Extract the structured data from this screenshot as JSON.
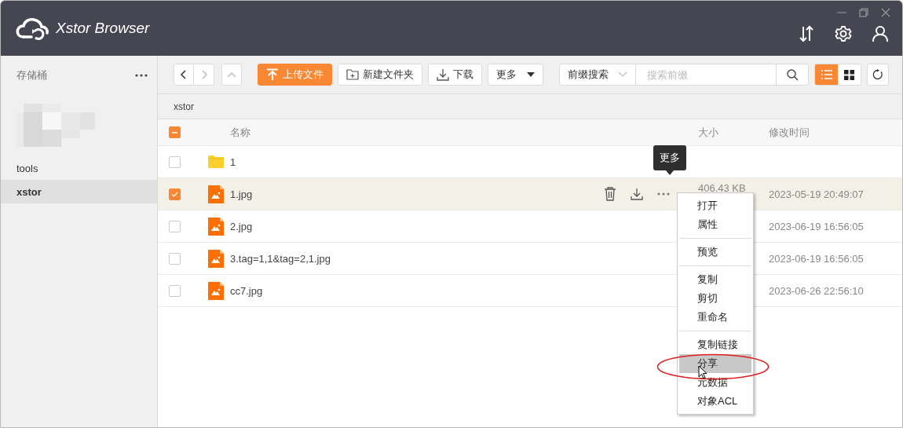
{
  "window": {
    "title": "Xstor Browser"
  },
  "sidebar": {
    "heading": "存储桶",
    "items": [
      {
        "kind": "redacted",
        "selected": false
      },
      {
        "kind": "bucket",
        "label": "tools",
        "selected": false
      },
      {
        "kind": "bucket",
        "label": "xstor",
        "selected": true
      }
    ]
  },
  "toolbar": {
    "nav": [
      {
        "kind": "back",
        "disabled": false
      },
      {
        "kind": "forward",
        "disabled": true
      },
      {
        "kind": "up",
        "disabled": true
      }
    ],
    "buttons": [
      {
        "kind": "upload",
        "label": "上传文件",
        "primary": true
      },
      {
        "kind": "new-folder",
        "label": "新建文件夹",
        "primary": false
      },
      {
        "kind": "download",
        "label": "下载",
        "primary": false
      },
      {
        "kind": "dropdown",
        "label": "更多",
        "primary": false
      }
    ],
    "search": {
      "mode": "前缀搜索",
      "placeholder": "搜索前缀"
    },
    "views": [
      {
        "kind": "list",
        "selected": true
      },
      {
        "kind": "grid",
        "selected": false
      }
    ]
  },
  "breadcrumb": "xstor",
  "table": {
    "select_all": {
      "indeterminate": true
    },
    "columns": [
      "名称",
      "大小",
      "修改时间"
    ],
    "rows": [
      {
        "kind": "folder",
        "name": "1",
        "checked": false,
        "hovered": false
      },
      {
        "kind": "image",
        "name": "1.jpg",
        "size": "406.43 KB",
        "modified": "2023-05-19 20:49:07",
        "checked": true,
        "hovered": true
      },
      {
        "kind": "image",
        "name": "2.jpg",
        "modified": "2023-06-19 16:56:05",
        "checked": false,
        "hovered": false
      },
      {
        "kind": "image",
        "name": "3.tag=1,1&tag=2,1.jpg",
        "modified": "2023-06-19 16:56:05",
        "checked": false,
        "hovered": false
      },
      {
        "kind": "image",
        "name": "cc7.jpg",
        "modified": "2023-06-26 22:56:10",
        "checked": false,
        "hovered": false
      }
    ]
  },
  "tooltip": {
    "text": "更多"
  },
  "context_menu": {
    "groups": [
      [
        {
          "label": "打开",
          "selected": false
        },
        {
          "label": "属性",
          "selected": false
        }
      ],
      [
        {
          "label": "预览",
          "selected": false
        }
      ],
      [
        {
          "label": "复制",
          "selected": false
        },
        {
          "label": "剪切",
          "selected": false
        },
        {
          "label": "重命名",
          "selected": false
        }
      ],
      [
        {
          "label": "复制链接",
          "selected": false
        },
        {
          "label": "分享",
          "selected": true
        },
        {
          "label": "元数据",
          "selected": false
        },
        {
          "label": "对象ACL",
          "selected": false
        }
      ]
    ]
  },
  "annotation": {
    "kind": "ellipse"
  }
}
